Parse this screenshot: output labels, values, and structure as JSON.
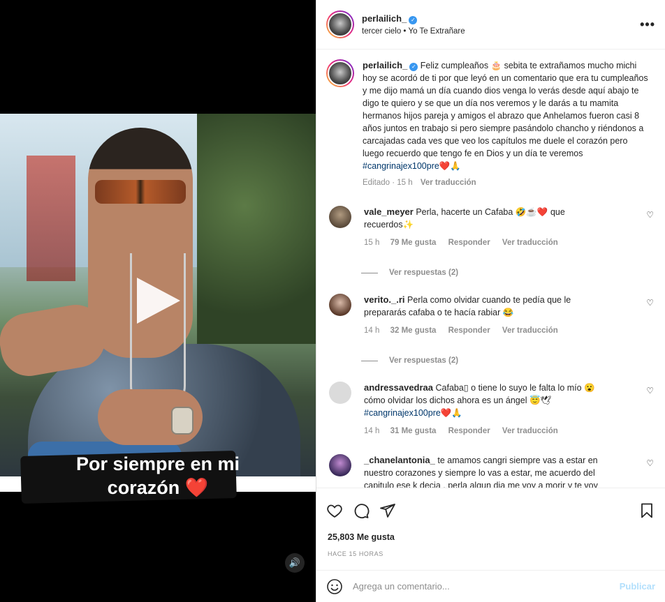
{
  "media": {
    "overlay_text_line1": "Por siempre en mi",
    "overlay_text_line2": "corazón ❤️",
    "sound_icon": "🔊"
  },
  "header": {
    "username": "perlailich_",
    "subtitle": "tercer cielo • Yo Te Extrañare",
    "more_label": "•••"
  },
  "post": {
    "username": "perlailich_",
    "caption": "Feliz cumpleaños 🎂 sebita te extrañamos mucho michi hoy se acordó de ti por que leyó en un comentario que era tu cumpleaños y me dijo mamá un día cuando dios venga lo verás desde aquí abajo te digo te quiero y se que un día nos veremos y le darás a tu mamita hermanos hijos pareja y amigos el abrazo que Anhelamos fueron casi 8 años juntos en trabajo si pero siempre pasándolo chancho y riéndonos a carcajadas cada ves que veo los capítulos me duele el corazón pero luego recuerdo que tengo fe en Dios y un día te veremos",
    "hashtag": "#cangrinajex100pre",
    "hashtag_emoji": "❤️🙏",
    "edited": "Editado · 15 h",
    "translate": "Ver traducción"
  },
  "comments": [
    {
      "username": "vale_meyer",
      "text": "Perla, hacerte un Cafaba 🤣☕❤️ que recuerdos✨",
      "age": "15 h",
      "likes": "79 Me gusta",
      "reply": "Responder",
      "translate": "Ver traducción",
      "replies": "Ver respuestas (2)",
      "avatar_color": "#7a6a55"
    },
    {
      "username": "verito._.ri",
      "text": "Perla como olvidar cuando te pedía que le prepararás cafaba o te hacía rabiar 😂",
      "age": "14 h",
      "likes": "32 Me gusta",
      "reply": "Responder",
      "translate": "Ver traducción",
      "replies": "Ver respuestas (2)",
      "avatar_color": "#8a6b5a"
    },
    {
      "username": "andressavedraa",
      "text": "Cafaba▯ o tiene lo suyo le falta lo mío 😮 cómo olvidar los dichos ahora es un ángel 😇🕊",
      "hashtag": "#cangrinajex100pre",
      "hashtag_emoji": "❤️🙏",
      "age": "14 h",
      "likes": "31 Me gusta",
      "reply": "Responder",
      "translate": "Ver traducción",
      "avatar_color": "#dbdbdb"
    },
    {
      "username": "_chanelantonia_",
      "text": "te amamos cangri siempre vas a estar en nuestro corazones y siempre lo vas a estar, me acuerdo del capitulo ese k decia , perla algun dia me voy a morir y te voy a",
      "avatar_color": "#6b4a8a"
    }
  ],
  "likes": "25,803 Me gusta",
  "time_ago": "HACE 15 HORAS",
  "add_comment": {
    "placeholder": "Agrega un comentario...",
    "publish": "Publicar"
  },
  "colors": {
    "link": "#00376b",
    "muted": "#8e8e8e",
    "verified": "#3897f0",
    "publish_disabled": "#b2dffc"
  }
}
